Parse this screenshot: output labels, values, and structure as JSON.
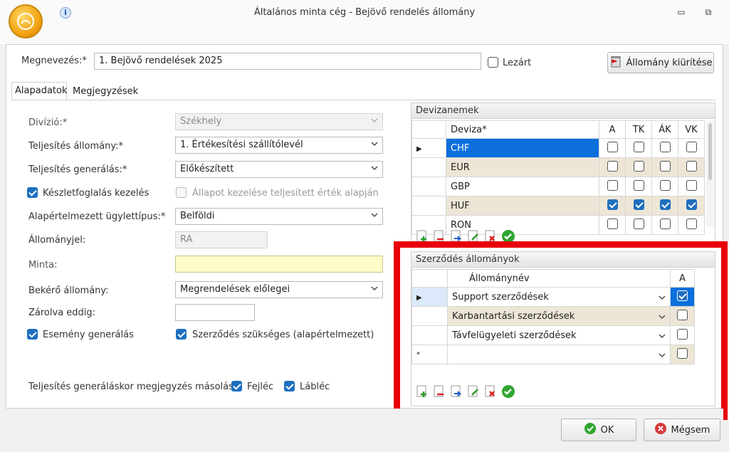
{
  "window": {
    "title": "Általános minta cég - Bejövő rendelés állomány",
    "min_glyph": "▭",
    "restore_glyph": "⧉"
  },
  "header": {
    "name_label": "Megnevezés:*",
    "name_value": "1. Bejövő rendelések 2025",
    "closed_label": "Lezárt",
    "clear_button": "Állomány kiürítése"
  },
  "tabs": [
    {
      "label": "Alapadatok"
    },
    {
      "label": "Megjegyzések"
    }
  ],
  "form": {
    "division_label": "Divízió:*",
    "division_value": "Székhely",
    "fulfill_label": "Teljesítés állomány:*",
    "fulfill_value": "1. Értékesítési szállítólevél",
    "gen_label": "Teljesítés generálás:*",
    "gen_value": "Előkészített",
    "stock_label": "Készletfoglalás kezelés",
    "state_label": "Állapot kezelése teljesített érték alapján",
    "deftype_label": "Alapértelmezett ügylettípus:*",
    "deftype_value": "Belföldi",
    "sign_label": "Állományjel:",
    "sign_value": "RA",
    "sample_label": "Minta:",
    "request_label": "Bekérő állomány:",
    "request_value": "Megrendelések előlegei",
    "locked_label": "Zárolva eddig:",
    "event_label": "Esemény generálás",
    "contract_label": "Szerződés szükséges (alapértelmezett)",
    "copy_label": "Teljesítés generáláskor megjegyzés másolás:",
    "header_label": "Fejléc",
    "footer_label": "Lábléc"
  },
  "currencies": {
    "title": "Devizanemek",
    "columns": [
      "Deviza*",
      "A",
      "TK",
      "ÁK",
      "VK"
    ],
    "rows": [
      {
        "name": "CHF",
        "checks": [
          false,
          false,
          false,
          false
        ],
        "selected": true
      },
      {
        "name": "EUR",
        "checks": [
          false,
          false,
          false,
          false
        ]
      },
      {
        "name": "GBP",
        "checks": [
          false,
          false,
          false,
          false
        ]
      },
      {
        "name": "HUF",
        "checks": [
          true,
          true,
          true,
          true
        ]
      },
      {
        "name": "RON",
        "checks": [
          false,
          false,
          false,
          false
        ]
      }
    ]
  },
  "contracts": {
    "title": "Szerződés állományok",
    "columns": [
      "Állománynév",
      "A"
    ],
    "rows": [
      {
        "name": "Support szerződések",
        "checked": true
      },
      {
        "name": "Karbantartási szerződések",
        "checked": false
      },
      {
        "name": "Távfelügyeleti szerződések",
        "checked": false
      },
      {
        "name": "",
        "checked": false
      }
    ],
    "new_row_marker": "*"
  },
  "footer": {
    "ok": "OK",
    "cancel": "Mégsem"
  },
  "colors": {
    "highlight_frame": "#e8000a",
    "selection": "#0c6fdc",
    "alt_row": "#ede6d6"
  }
}
